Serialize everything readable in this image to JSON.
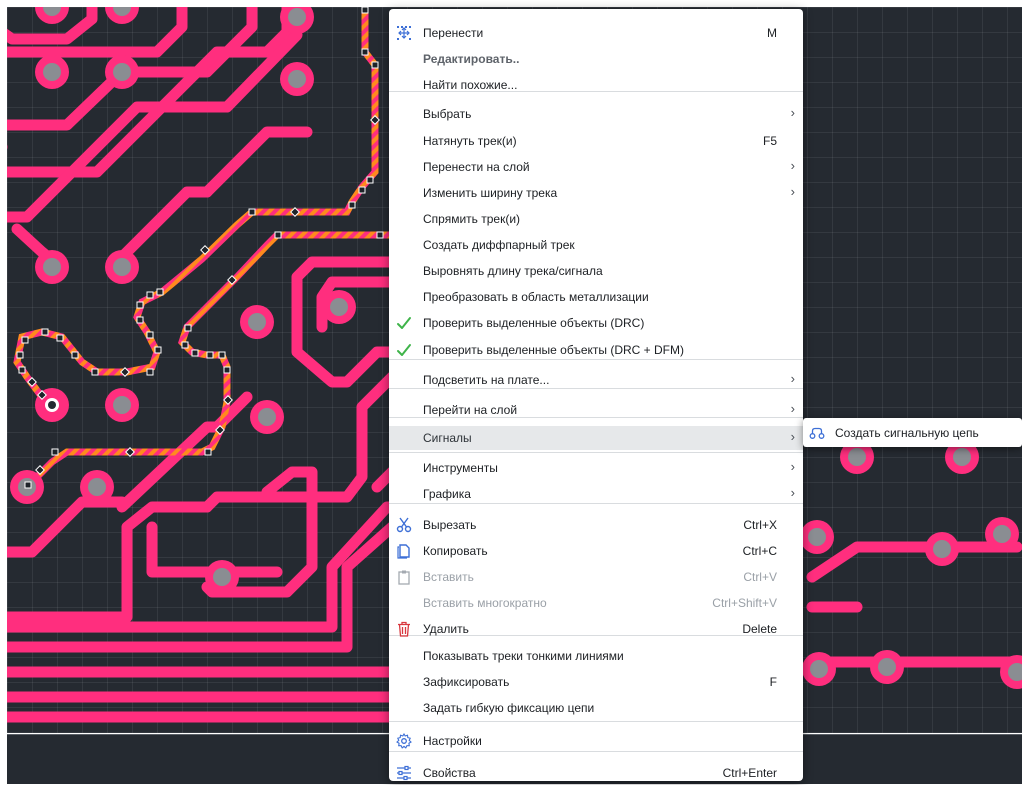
{
  "context_menu": {
    "items": [
      {
        "label": "Перенести",
        "shortcut": "M",
        "icon": "move-icon"
      },
      {
        "label": "Редактировать..",
        "bold": true
      },
      {
        "label": "Найти похожие..."
      },
      {
        "label": "Выбрать",
        "submenu": true
      },
      {
        "label": "Натянуть трек(и)",
        "shortcut": "F5"
      },
      {
        "label": "Перенести на слой",
        "submenu": true
      },
      {
        "label": "Изменить ширину трека",
        "submenu": true
      },
      {
        "label": "Спрямить трек(и)"
      },
      {
        "label": "Создать диффпарный трек"
      },
      {
        "label": "Выровнять длину трека/сигнала"
      },
      {
        "label": "Преобразовать в область металлизации"
      },
      {
        "label": "Проверить выделенные объекты (DRC)",
        "icon": "check-icon"
      },
      {
        "label": "Проверить выделенные объекты (DRC + DFM)",
        "icon": "check-icon"
      },
      {
        "label": "Подсветить на плате...",
        "submenu": true
      },
      {
        "label": "Перейти на слой",
        "submenu": true
      },
      {
        "label": "Сигналы",
        "submenu": true,
        "active": true
      },
      {
        "label": "Инструменты",
        "submenu": true
      },
      {
        "label": "Графика",
        "submenu": true
      },
      {
        "label": "Вырезать",
        "shortcut": "Ctrl+X",
        "icon": "scissors-icon"
      },
      {
        "label": "Копировать",
        "shortcut": "Ctrl+C",
        "icon": "copy-icon"
      },
      {
        "label": "Вставить",
        "shortcut": "Ctrl+V",
        "icon": "paste-icon",
        "disabled": true
      },
      {
        "label": "Вставить многократно",
        "shortcut": "Ctrl+Shift+V",
        "disabled": true
      },
      {
        "label": "Удалить",
        "shortcut": "Delete",
        "icon": "trash-icon"
      },
      {
        "label": "Показывать треки тонкими линиями"
      },
      {
        "label": "Зафиксировать",
        "shortcut": "F"
      },
      {
        "label": "Задать гибкую фиксацию цепи"
      },
      {
        "label": "Настройки",
        "icon": "gear-icon"
      },
      {
        "label": "Свойства",
        "shortcut": "Ctrl+Enter",
        "icon": "sliders-icon"
      }
    ]
  },
  "submenu": {
    "label": "Создать сигнальную цепь",
    "icon": "signal-chain-icon"
  },
  "colors": {
    "canvas_bg": "#252a31",
    "trace": "#ff2e7e",
    "pad_center": "#8a8d92",
    "selected_stripe_a": "#ff8a1e",
    "selected_stripe_b": "#ff2e7e",
    "check_green": "#3fb44a",
    "delete_red": "#d9383f",
    "icon_blue": "#3d6fd6"
  }
}
